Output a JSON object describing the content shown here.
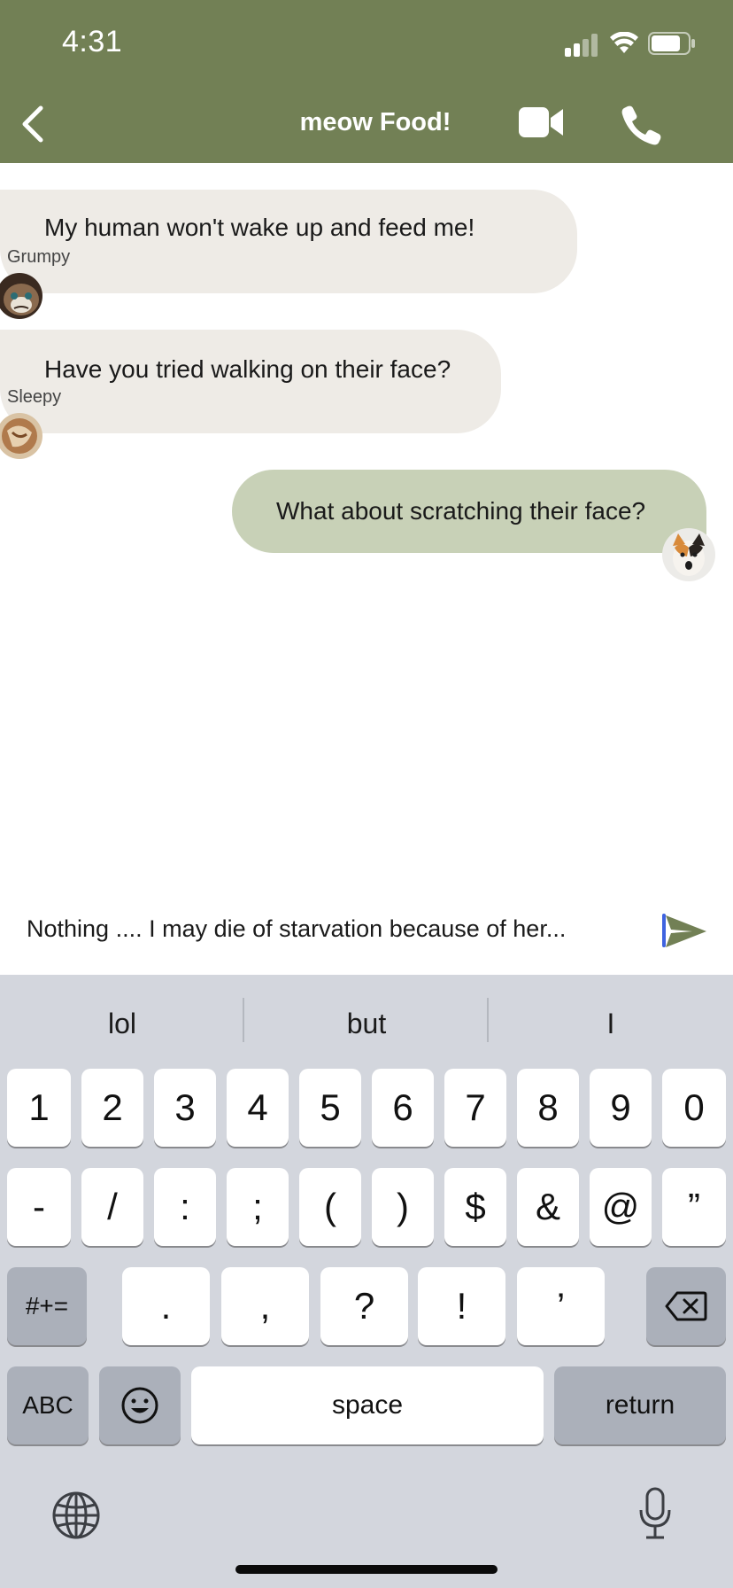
{
  "status_bar": {
    "time": "4:31"
  },
  "header": {
    "title": "meow Food!",
    "back_icon": "chevron-left-icon",
    "video_icon": "video-camera-icon",
    "call_icon": "phone-icon"
  },
  "messages": [
    {
      "sender": "Grumpy",
      "text": "My human won't wake up and feed me!",
      "direction": "incoming"
    },
    {
      "sender": "Sleepy",
      "text": "Have you tried walking on their face?",
      "direction": "incoming"
    },
    {
      "sender": "",
      "text": "What about scratching their face?",
      "direction": "outgoing"
    }
  ],
  "composer": {
    "value": "Nothing .... I  may die of starvation because of her...",
    "send_icon": "send-icon"
  },
  "keyboard": {
    "suggestions": [
      "lol",
      "but",
      "I"
    ],
    "row1": [
      "1",
      "2",
      "3",
      "4",
      "5",
      "6",
      "7",
      "8",
      "9",
      "0"
    ],
    "row2": [
      "-",
      "/",
      ":",
      ";",
      "(",
      ")",
      "$",
      "&",
      "@",
      "”"
    ],
    "row3_mode": "#+=",
    "row3": [
      ".",
      ",",
      "?",
      "!",
      "’"
    ],
    "abc_label": "ABC",
    "space_label": "space",
    "return_label": "return",
    "delete_icon": "backspace-icon",
    "emoji_icon": "emoji-icon",
    "globe_icon": "globe-icon",
    "mic_icon": "microphone-icon"
  },
  "colors": {
    "header": "#728055",
    "incoming_bubble": "#eeebe6",
    "outgoing_bubble": "#c8d1b7",
    "keyboard_bg": "#d3d6dd",
    "send_accent": "#728055"
  }
}
